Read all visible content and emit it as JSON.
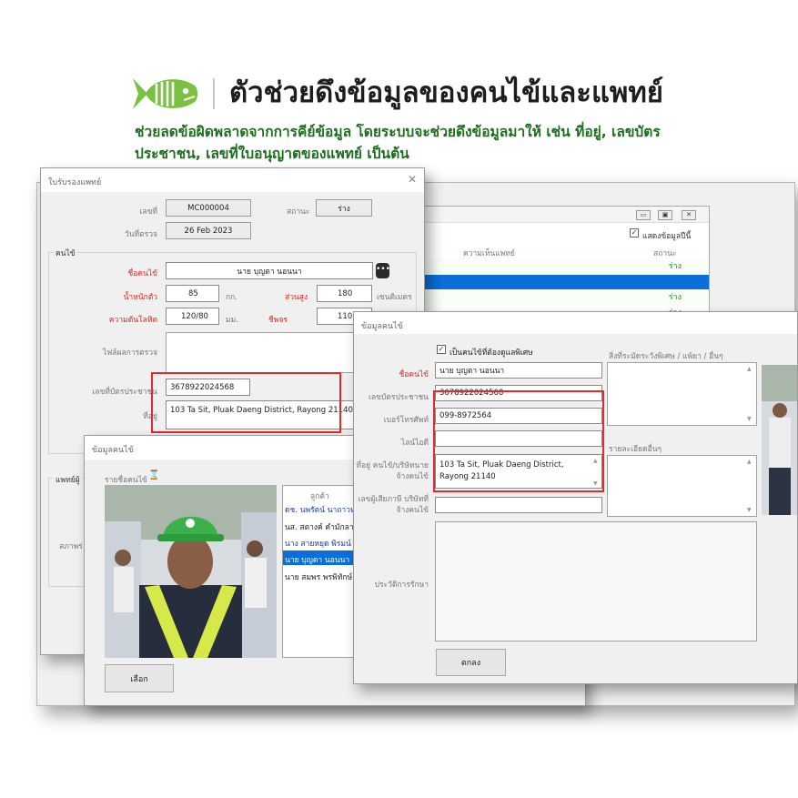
{
  "header": {
    "title": "ตัวช่วยดึงข้อมูลของคนไข้และแพทย์",
    "subtitle": "ช่วยลดข้อผิดพลาดจากการคีย์ข้อมูล โดยระบบจะช่วยดึงข้อมูลมาให้ เช่น ที่อยู่, เลขบัตรประชาชน, เลขที่ใบอนุญาตของแพทย์ เป็นต้น",
    "colors": {
      "accent_green": "#7ac142",
      "subtitle_green": "#1b6f1b",
      "highlight_red": "#e32b2b"
    }
  },
  "list_window": {
    "show_today_label": "แสดงข้อมูลปีนี้",
    "col_opinion": "ความเห็นแพทย์",
    "col_status": "สถานะ",
    "rows": [
      "ร่าง",
      "",
      "ร่าง",
      "ร่าง"
    ]
  },
  "doctor_window": {
    "title": "ใบรับรองแพทย์",
    "number_label": "เลขที่",
    "number_value": "MC000004",
    "status_label": "สถานะ",
    "status_value": "ร่าง",
    "date_label": "วันที่ตรวจ",
    "date_value": "26 Feb 2023",
    "patient_section": "คนไข้",
    "patient_name_label": "ชื่อคนไข้",
    "patient_name_value": "นาย บุญตา นอนนา",
    "weight_label": "น้ำหนักตัว",
    "weight_value": "85",
    "weight_unit": "กก.",
    "height_label": "ส่วนสูง",
    "height_value": "180",
    "height_unit": "เซนติเมตร",
    "bp_label": "ความดันโลหิต",
    "bp_value": "120/80",
    "bp_unit": "มม.",
    "pulse_label": "ชีพจร",
    "pulse_value": "110",
    "result_label": "ไฟล์ผลการตรวจ",
    "idcard_label": "เลขที่บัตรประชาชน",
    "idcard_value": "3678922024568",
    "address_label": "ที่อยู่",
    "address_value": "103 Ta Sit, Pluak Daeng District, Rayong 21140",
    "doctor_section": "แพทย์ผู้",
    "condition_label": "สภาพร่"
  },
  "customer_window": {
    "title": "ข้อมูลคนไข้",
    "list_label": "รายชื่อคนไข้",
    "column_header": "ลูกค้า",
    "customers": [
      "ดช. นพรัตน์ นาถาวห",
      "นส. สตางค์ คำมักลา",
      "นาง สายหยุด พิรมน์",
      "นาย บุญตา นอนนา",
      "นาย สมพร พรพิทักษ์"
    ],
    "selected_index": 3,
    "select_button": "เลือก"
  },
  "patient_window": {
    "title": "ข้อมูลคนไข้",
    "special_care_label": "เป็นคนไข้ที่ต้องดูแลพิเศษ",
    "special_care_checked": true,
    "name_label": "ชื่อคนไข้",
    "name_value": "นาย บุญตา นอนนา",
    "idcard_label": "เลขบัตรประชาชน",
    "idcard_value": "3678922024568",
    "phone_label": "เบอร์โทรศัพท์",
    "phone_value": "099-8972564",
    "line_label": "ไลน์ไอดี",
    "line_value": "",
    "address_label": "ที่อยู่ คนไข้/บริษัทนาย จ้างคนไข้",
    "address_value": "103 Ta Sit, Pluak Daeng District, Rayong 21140",
    "insurance_label": "เลขผู้เสียภาษี บริษัทที่จ้างคนไข้",
    "special_note_label": "สิ่งที่ระมัดระวังพิเศษ / แพ้ยา / อื่นๆ",
    "other_detail_label": "รายละเอียดอื่นๆ",
    "history_label": "ประวัติการรักษา",
    "ok_button": "ตกลง"
  }
}
